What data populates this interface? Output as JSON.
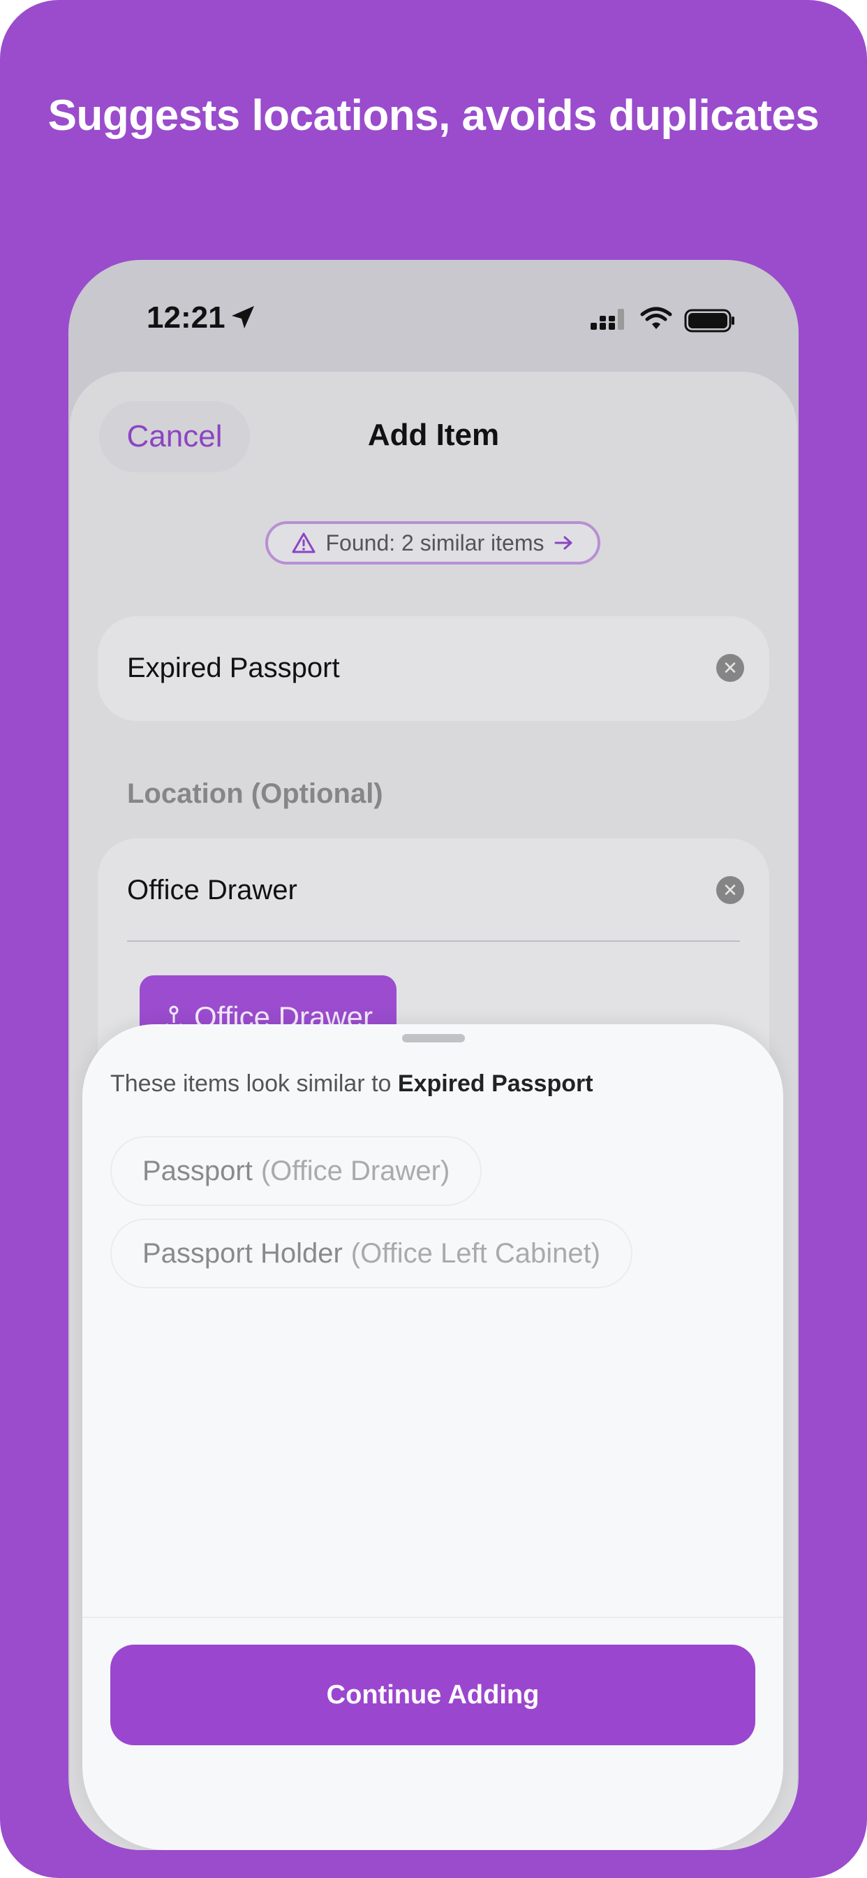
{
  "headline": "Suggests locations, avoids duplicates",
  "status_bar": {
    "time": "12:21"
  },
  "nav": {
    "cancel_label": "Cancel",
    "title": "Add Item"
  },
  "duplicate_pill": {
    "text": "Found: 2 similar items"
  },
  "item_field": {
    "value": "Expired Passport"
  },
  "location": {
    "section_label": "Location (Optional)",
    "value": "Office Drawer",
    "suggestion": "Office Drawer"
  },
  "similar_sheet": {
    "intro": "These items look similar to ",
    "intro_item": "Expired Passport",
    "items": [
      {
        "name": "Passport",
        "location": "(Office Drawer)"
      },
      {
        "name": "Passport Holder",
        "location": "(Office Left Cabinet)"
      }
    ],
    "continue_label": "Continue Adding"
  },
  "colors": {
    "brand": "#9a4ccc",
    "accent": "#9b46cf"
  }
}
